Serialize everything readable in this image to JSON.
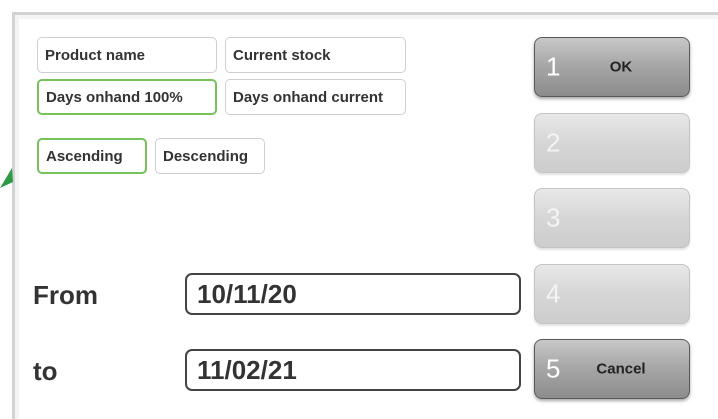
{
  "sort_fields": [
    {
      "label": "Product name",
      "selected": false
    },
    {
      "label": "Current stock",
      "selected": false
    },
    {
      "label": "Days onhand 100%",
      "selected": true
    },
    {
      "label": "Days onhand current",
      "selected": false
    }
  ],
  "sort_order": [
    {
      "label": "Ascending",
      "selected": true
    },
    {
      "label": "Descending",
      "selected": false
    }
  ],
  "date_range": {
    "from_label": "From",
    "from_value": "10/11/20",
    "to_label": "to",
    "to_value": "11/02/21"
  },
  "side_buttons": [
    {
      "num": "1",
      "label": "OK",
      "enabled": true
    },
    {
      "num": "2",
      "label": "",
      "enabled": false
    },
    {
      "num": "3",
      "label": "",
      "enabled": false
    },
    {
      "num": "4",
      "label": "",
      "enabled": false
    },
    {
      "num": "5",
      "label": "Cancel",
      "enabled": true
    }
  ],
  "colors": {
    "selected_border": "#76c25b",
    "arrow": "#2e9a44"
  },
  "icons": {
    "pointer": "green-arrow-icon"
  }
}
